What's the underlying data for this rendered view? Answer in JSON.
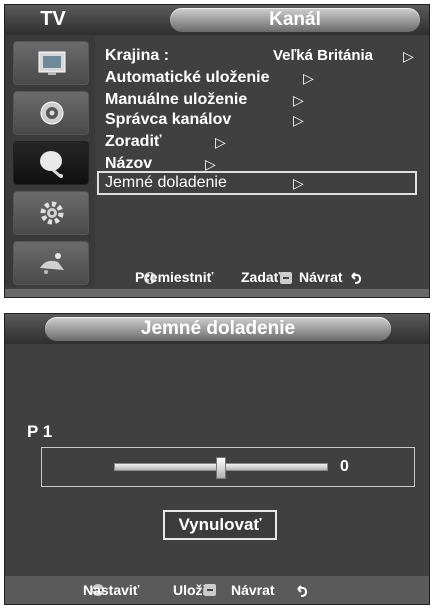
{
  "top_panel": {
    "tv_label": "TV",
    "title": "Kanál",
    "menu": {
      "items": [
        {
          "label": "Krajina  :",
          "value": "Veľká Británia",
          "arrow": "▷"
        },
        {
          "label": "Automatické uloženie",
          "arrow": "▷"
        },
        {
          "label": "Manuálne uloženie",
          "arrow": "▷"
        },
        {
          "label": "Správca kanálov",
          "arrow": "▷"
        },
        {
          "label": "Zoradiť",
          "arrow": "▷"
        },
        {
          "label": "Názov",
          "arrow": "▷"
        },
        {
          "label": "Jemné doladenie",
          "arrow": "▷"
        }
      ],
      "selected_index": 6
    },
    "sidebar": {
      "icons": [
        "picture-icon",
        "sound-icon",
        "channel-icon",
        "setup-icon",
        "input-icon"
      ],
      "active_index": 2
    },
    "footer": {
      "move": "Premiestniť",
      "enter": "Zadať",
      "back": "Návrat"
    }
  },
  "bottom_panel": {
    "title": "Jemné doladenie",
    "channel": "P 1",
    "slider": {
      "value": "0",
      "level": 0.5
    },
    "reset_label": "Vynulovať",
    "footer": {
      "adjust": "Nastaviť",
      "save": "Uložiť",
      "back": "Návrat"
    }
  },
  "colors": {
    "panel_bg": "#404040",
    "header_pill": "#a0a0a0",
    "text": "#ffffff",
    "selection_border": "#e0e0e0"
  }
}
